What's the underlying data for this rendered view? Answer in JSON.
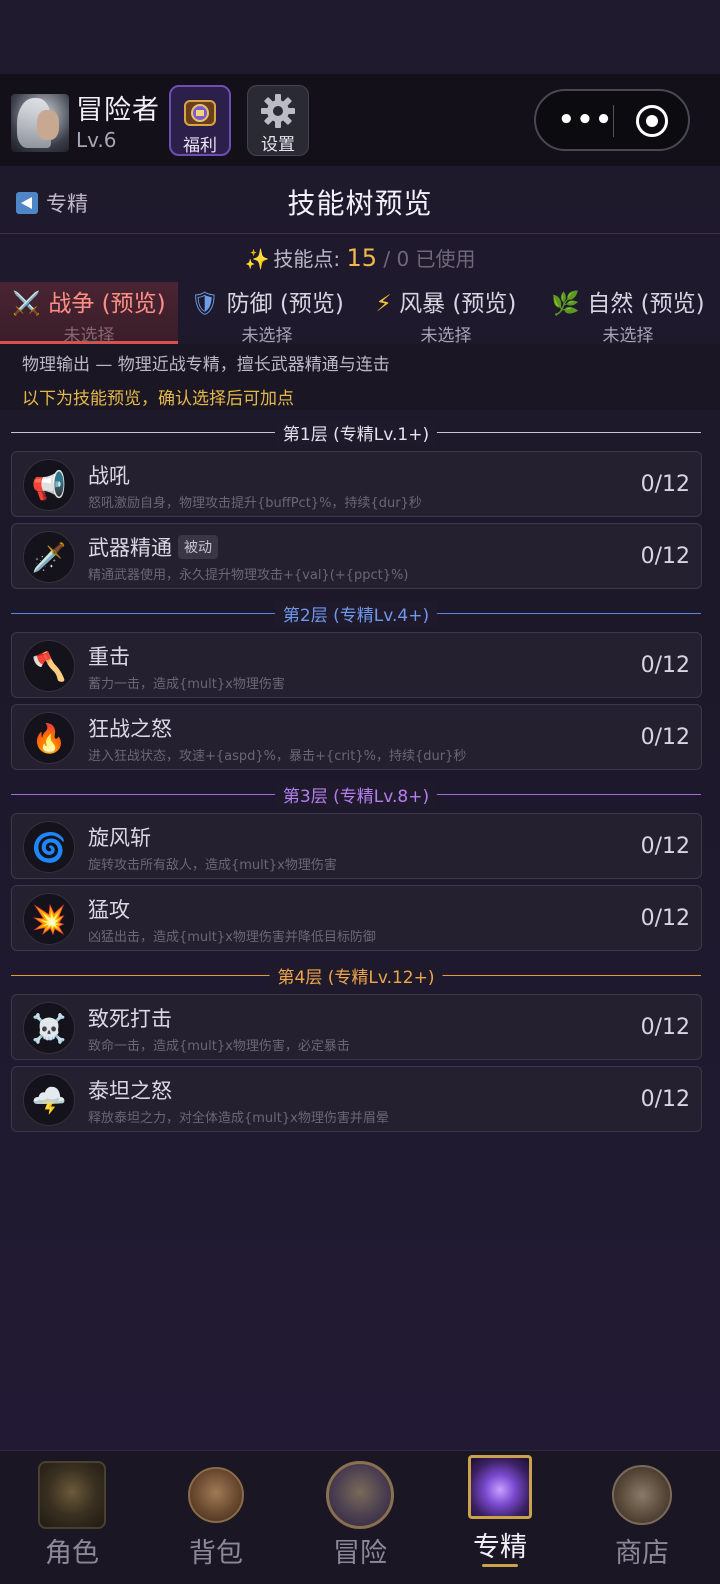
{
  "player": {
    "name": "冒险者",
    "level": "Lv.6"
  },
  "header_buttons": {
    "welfare": "福利",
    "settings": "设置"
  },
  "page": {
    "back_label": "专精",
    "title": "技能树预览"
  },
  "skill_points": {
    "label": "技能点:",
    "value": "15",
    "used": "/ 0 已使用"
  },
  "tabs": [
    {
      "name": "战争 (预览)",
      "status": "未选择",
      "icon": "⚔️",
      "active": true
    },
    {
      "name": "防御 (预览)",
      "status": "未选择",
      "icon": "🛡"
    },
    {
      "name": "风暴 (预览)",
      "status": "未选择",
      "icon": "⚡"
    },
    {
      "name": "自然 (预览)",
      "status": "未选择",
      "icon": "🌿"
    }
  ],
  "description": {
    "line1": "物理输出 — 物理近战专精，擅长武器精通与连击",
    "line2": "以下为技能预览，确认选择后可加点"
  },
  "tiers": [
    {
      "label": "第1层 (专精Lv.1+)",
      "color": "#c9c5d2"
    },
    {
      "label": "第2层 (专精Lv.4+)",
      "color": "#5b86e0"
    },
    {
      "label": "第3层 (专精Lv.8+)",
      "color": "#a667e0"
    },
    {
      "label": "第4层 (专精Lv.12+)",
      "color": "#e59a3d"
    }
  ],
  "skills": [
    {
      "name": "战吼",
      "desc": "怒吼激励自身，物理攻击提升{buffPct}%，持续{dur}秒",
      "count": "0/12",
      "icon": "📢"
    },
    {
      "name": "武器精通",
      "tag": "被动",
      "desc": "精通武器使用，永久提升物理攻击+{val}(+{ppct}%)",
      "count": "0/12",
      "icon": "🗡️"
    },
    {
      "name": "重击",
      "desc": "蓄力一击，造成{mult}x物理伤害",
      "count": "0/12",
      "icon": "🪓"
    },
    {
      "name": "狂战之怒",
      "desc": "进入狂战状态，攻速+{aspd}%，暴击+{crit}%，持续{dur}秒",
      "count": "0/12",
      "icon": "🔥"
    },
    {
      "name": "旋风斩",
      "desc": "旋转攻击所有敌人，造成{mult}x物理伤害",
      "count": "0/12",
      "icon": "🌀"
    },
    {
      "name": "猛攻",
      "desc": "凶猛出击，造成{mult}x物理伤害并降低目标防御",
      "count": "0/12",
      "icon": "💥"
    },
    {
      "name": "致死打击",
      "desc": "致命一击，造成{mult}x物理伤害，必定暴击",
      "count": "0/12",
      "icon": "☠️"
    },
    {
      "name": "泰坦之怒",
      "desc": "释放泰坦之力，对全体造成{mult}x物理伤害并眉晕",
      "count": "0/12",
      "icon": "🌩️"
    }
  ],
  "nav": [
    {
      "label": "角色"
    },
    {
      "label": "背包"
    },
    {
      "label": "冒险"
    },
    {
      "label": "专精",
      "active": true
    },
    {
      "label": "商店"
    }
  ]
}
